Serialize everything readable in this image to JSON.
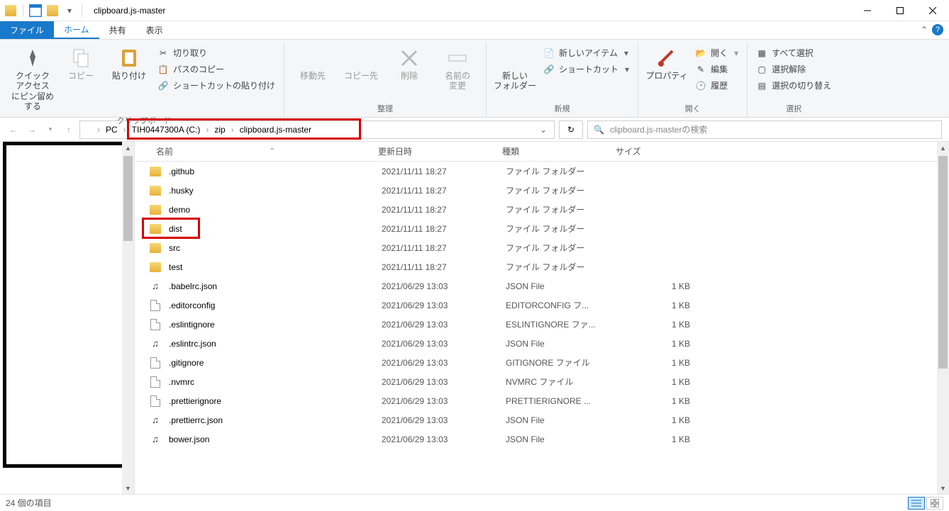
{
  "window": {
    "title": "clipboard.js-master"
  },
  "tabs": {
    "file": "ファイル",
    "home": "ホーム",
    "share": "共有",
    "view": "表示"
  },
  "ribbon": {
    "clipboard": {
      "label": "クリップボード",
      "pin": "クイック アクセス\nにピン留めする",
      "copy": "コピー",
      "paste": "貼り付け",
      "cut": "切り取り",
      "copyPath": "パスのコピー",
      "pasteShortcut": "ショートカットの貼り付け"
    },
    "organize": {
      "label": "整理",
      "moveTo": "移動先",
      "copyTo": "コピー先",
      "delete": "削除",
      "rename": "名前の\n変更"
    },
    "new": {
      "label": "新規",
      "newFolder": "新しい\nフォルダー",
      "newItem": "新しいアイテム",
      "shortcut": "ショートカット"
    },
    "open": {
      "label": "開く",
      "properties": "プロパティ",
      "open": "開く",
      "edit": "編集",
      "history": "履歴"
    },
    "select": {
      "label": "選択",
      "selectAll": "すべて選択",
      "selectNone": "選択解除",
      "invert": "選択の切り替え"
    }
  },
  "breadcrumb": [
    "PC",
    "TIH0447300A (C:)",
    "zip",
    "clipboard.js-master"
  ],
  "search": {
    "placeholder": "clipboard.js-masterの検索"
  },
  "columns": {
    "name": "名前",
    "date": "更新日時",
    "type": "種類",
    "size": "サイズ"
  },
  "files": [
    {
      "icon": "folder",
      "name": ".github",
      "date": "2021/11/11 18:27",
      "type": "ファイル フォルダー",
      "size": ""
    },
    {
      "icon": "folder",
      "name": ".husky",
      "date": "2021/11/11 18:27",
      "type": "ファイル フォルダー",
      "size": ""
    },
    {
      "icon": "folder",
      "name": "demo",
      "date": "2021/11/11 18:27",
      "type": "ファイル フォルダー",
      "size": ""
    },
    {
      "icon": "folder",
      "name": "dist",
      "date": "2021/11/11 18:27",
      "type": "ファイル フォルダー",
      "size": "",
      "highlight": true
    },
    {
      "icon": "folder",
      "name": "src",
      "date": "2021/11/11 18:27",
      "type": "ファイル フォルダー",
      "size": ""
    },
    {
      "icon": "folder",
      "name": "test",
      "date": "2021/11/11 18:27",
      "type": "ファイル フォルダー",
      "size": ""
    },
    {
      "icon": "json",
      "name": ".babelrc.json",
      "date": "2021/06/29 13:03",
      "type": "JSON File",
      "size": "1 KB"
    },
    {
      "icon": "file",
      "name": ".editorconfig",
      "date": "2021/06/29 13:03",
      "type": "EDITORCONFIG フ...",
      "size": "1 KB"
    },
    {
      "icon": "file",
      "name": ".eslintignore",
      "date": "2021/06/29 13:03",
      "type": "ESLINTIGNORE ファ...",
      "size": "1 KB"
    },
    {
      "icon": "json",
      "name": ".eslintrc.json",
      "date": "2021/06/29 13:03",
      "type": "JSON File",
      "size": "1 KB"
    },
    {
      "icon": "file",
      "name": ".gitignore",
      "date": "2021/06/29 13:03",
      "type": "GITIGNORE ファイル",
      "size": "1 KB"
    },
    {
      "icon": "file",
      "name": ".nvmrc",
      "date": "2021/06/29 13:03",
      "type": "NVMRC ファイル",
      "size": "1 KB"
    },
    {
      "icon": "file",
      "name": ".prettierignore",
      "date": "2021/06/29 13:03",
      "type": "PRETTIERIGNORE ...",
      "size": "1 KB"
    },
    {
      "icon": "json",
      "name": ".prettierrc.json",
      "date": "2021/06/29 13:03",
      "type": "JSON File",
      "size": "1 KB"
    },
    {
      "icon": "json",
      "name": "bower.json",
      "date": "2021/06/29 13:03",
      "type": "JSON File",
      "size": "1 KB"
    }
  ],
  "status": {
    "count": "24 個の項目"
  }
}
